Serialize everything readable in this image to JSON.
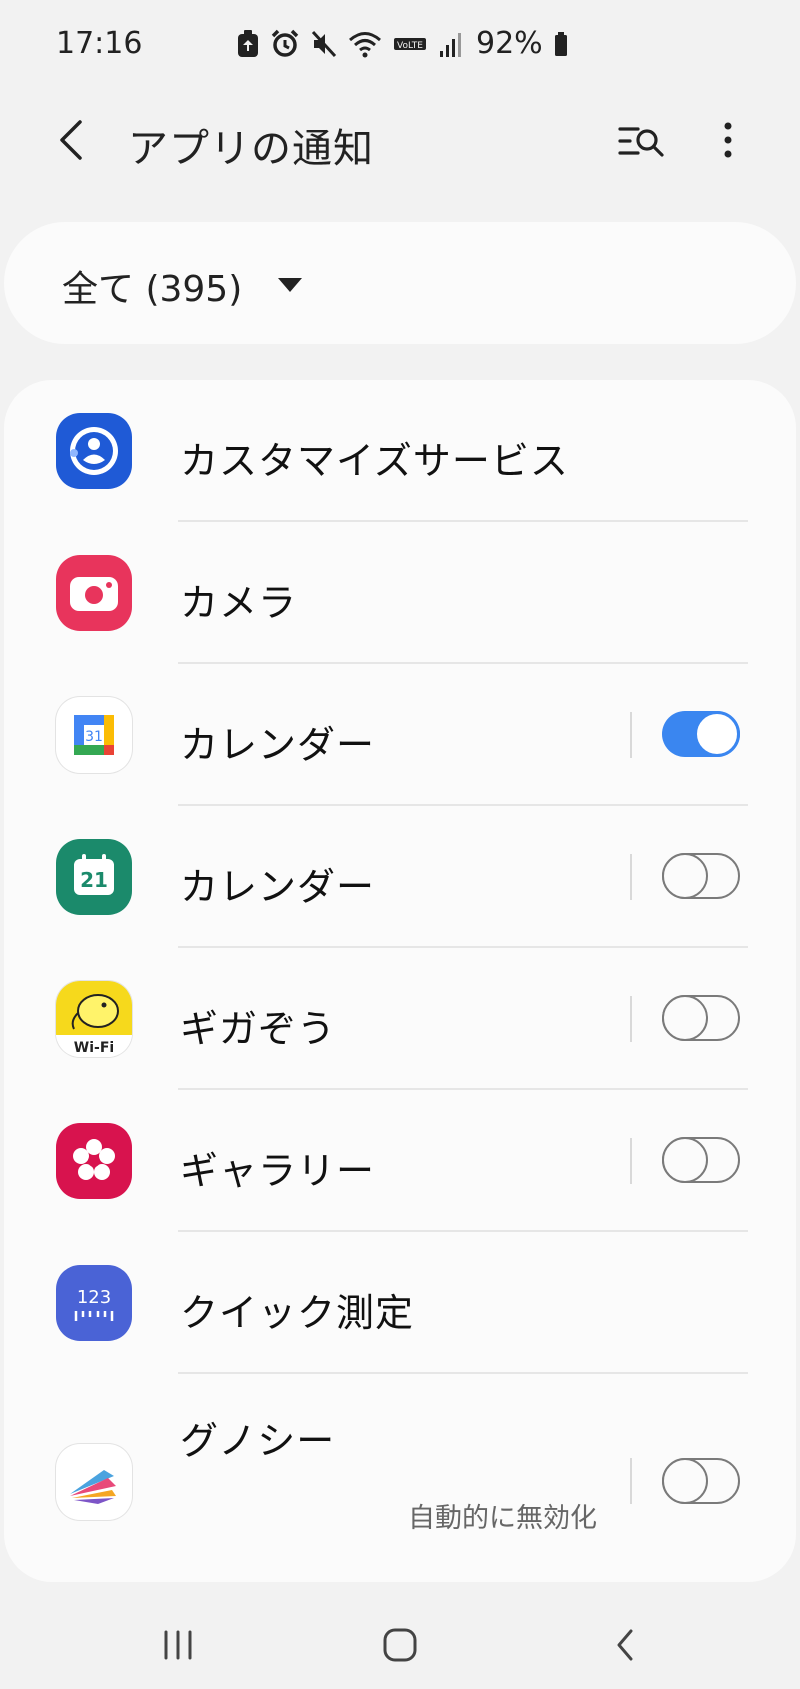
{
  "status_bar": {
    "time": "17:16",
    "battery": "92%",
    "icons": [
      "battery-saver-icon",
      "alarm-icon",
      "mute-icon",
      "wifi-icon",
      "volte-icon",
      "signal-icon",
      "battery-icon"
    ]
  },
  "header": {
    "title": "アプリの通知",
    "back_icon": "chevron-left-icon",
    "search_icon": "search-list-icon",
    "more_icon": "more-vert-icon"
  },
  "filter": {
    "label": "全て (395)",
    "icon": "dropdown-arrow-icon"
  },
  "apps": [
    {
      "name": "カスタマイズサービス",
      "icon": "customization-service-icon",
      "icon_color": "#1f5ad6",
      "toggle": null
    },
    {
      "name": "カメラ",
      "icon": "camera-icon",
      "icon_color": "#e8345c",
      "toggle": null
    },
    {
      "name": "カレンダー",
      "icon": "google-calendar-icon",
      "icon_color": "#ffffff",
      "toggle": true
    },
    {
      "name": "カレンダー",
      "icon": "samsung-calendar-icon",
      "icon_color": "#1b8a6b",
      "toggle": false
    },
    {
      "name": "ギガぞう",
      "icon": "gigazou-icon",
      "icon_color": "#f6d91c",
      "toggle": false
    },
    {
      "name": "ギャラリー",
      "icon": "gallery-icon",
      "icon_color": "#d8134e",
      "toggle": false
    },
    {
      "name": "クイック測定",
      "icon": "quick-measure-icon",
      "icon_color": "#4a63d6",
      "toggle": null
    },
    {
      "name": "グノシー",
      "icon": "gunosy-icon",
      "icon_color": "#ffffff",
      "toggle": false,
      "status": "自動的に無効化"
    }
  ],
  "nav_bar": {
    "recents_icon": "recents-icon",
    "home_icon": "home-icon",
    "back_icon": "back-icon"
  },
  "colors": {
    "accent": "#3a86f0",
    "background": "#f2f2f2",
    "card": "#fbfbfb"
  }
}
